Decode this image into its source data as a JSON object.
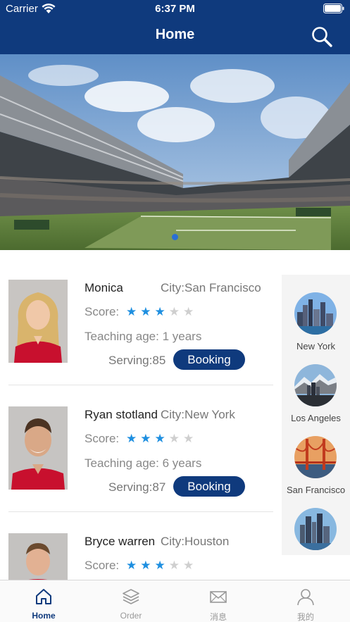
{
  "status_bar": {
    "carrier": "Carrier",
    "time": "6:37 PM"
  },
  "header": {
    "title": "Home"
  },
  "banner": {
    "image": "tennis-stadium-photo",
    "page_indicator": {
      "current": 1,
      "total": 1
    }
  },
  "coaches": [
    {
      "name": "Monica",
      "city": "City:San Francisco",
      "score_label": "Score:",
      "rating": 3,
      "max_rating": 5,
      "teaching_age": "Teaching age: 1 years",
      "serving": "Serving:85",
      "booking_label": "Booking"
    },
    {
      "name": "Ryan stotland",
      "city": "City:New York",
      "score_label": "Score:",
      "rating": 3,
      "max_rating": 5,
      "teaching_age": "Teaching age: 6 years",
      "serving": "Serving:87",
      "booking_label": "Booking"
    },
    {
      "name": "Bryce warren",
      "city": "City:Houston",
      "score_label": "Score:",
      "rating": 3,
      "max_rating": 5,
      "teaching_age": "",
      "serving": "",
      "booking_label": ""
    }
  ],
  "cities": [
    {
      "name": "New York"
    },
    {
      "name": "Los Angeles"
    },
    {
      "name": "San Francisco"
    },
    {
      "name": ""
    }
  ],
  "tabbar": {
    "tabs": [
      {
        "label": "Home",
        "icon": "home-icon",
        "active": true
      },
      {
        "label": "Order",
        "icon": "layers-icon",
        "active": false
      },
      {
        "label": "消息",
        "icon": "mail-icon",
        "active": false
      },
      {
        "label": "我的",
        "icon": "user-icon",
        "active": false
      }
    ]
  },
  "colors": {
    "primary": "#0f3a7d",
    "star": "#1e8fe0",
    "star_off": "#cfcfcf"
  }
}
